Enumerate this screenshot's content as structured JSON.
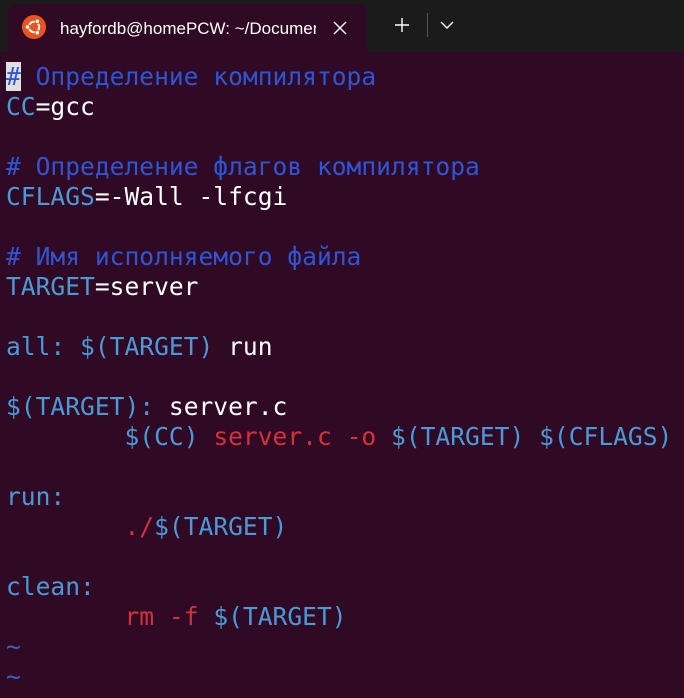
{
  "tab": {
    "title": "hayfordb@homePCW: ~/Documents",
    "icon": "ubuntu-icon"
  },
  "toolbar": {
    "new_tab_symbol": "+",
    "dropdown_symbol": "⌄"
  },
  "editor": {
    "lines": {
      "l1": {
        "hash": "#",
        "text": " Определение компилятора"
      },
      "l2": {
        "name": "CC",
        "eq": "=gcc"
      },
      "l4": {
        "text": "# Определение флагов компилятора"
      },
      "l5": {
        "name": "CFLAGS",
        "eq": "=-Wall -lfcgi"
      },
      "l7": {
        "text": "# Имя исполняемого файла"
      },
      "l8": {
        "name": "TARGET",
        "eq": "=server"
      },
      "l10": {
        "target": "all:",
        "deps": " $(TARGET)",
        "rest": " run"
      },
      "l11": {
        "target": "$(TARGET):",
        "rest": " server.c"
      },
      "l12": {
        "indent": "        ",
        "cc": "$(CC)",
        "args": " server.c -o ",
        "t": "$(TARGET)",
        "sp": " ",
        "flags": "$(CFLAGS)"
      },
      "l14": {
        "target": "run:"
      },
      "l15": {
        "indent": "        ",
        "path": "./",
        "t": "$(TARGET)"
      },
      "l17": {
        "target": "clean:"
      },
      "l18": {
        "indent": "        ",
        "cmd": "rm -f",
        "sp": " ",
        "t": "$(TARGET)"
      },
      "l19": {
        "tilde": "~"
      },
      "l20": {
        "tilde": "~"
      }
    }
  },
  "colors": {
    "background": "#300a24",
    "comment": "#2e55d6",
    "variable": "#4a9ad8",
    "command": "#d6303c",
    "text": "#ffffff"
  }
}
